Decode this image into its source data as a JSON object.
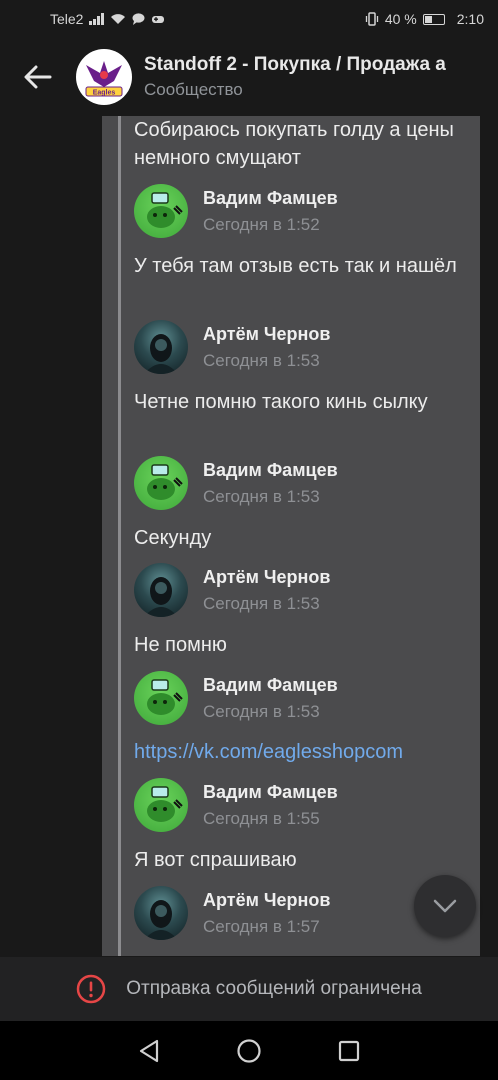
{
  "status_bar": {
    "carrier": "Tele2",
    "battery": "40 %",
    "time": "2:10"
  },
  "header": {
    "title": "Standoff 2 - Покупка / Продажа а",
    "subtitle": "Сообщество",
    "avatar_text": "Eagles"
  },
  "thread": {
    "messages": [
      {
        "text": "Собираюсь покупать голду а цены немного смущают"
      },
      {
        "author": "Вадим Фамцев",
        "time": "Сегодня в 1:52",
        "text": "У тебя там отзыв есть так и нашёл"
      },
      {
        "author": "Артём Чернов",
        "time": "Сегодня в 1:53",
        "text": "Четне помню такого кинь сылку"
      },
      {
        "author": "Вадим Фамцев",
        "time": "Сегодня в 1:53",
        "text": "Секунду"
      },
      {
        "author": "Артём Чернов",
        "time": "Сегодня в 1:53",
        "text": "Не помню"
      },
      {
        "author": "Вадим Фамцев",
        "time": "Сегодня в 1:53",
        "link": "https://vk.com/eaglesshopcom"
      },
      {
        "author": "Вадим Фамцев",
        "time": "Сегодня в 1:55",
        "text": "Я вот спрашиваю"
      },
      {
        "author": "Артём Чернов",
        "time": "Сегодня в 1:57"
      }
    ]
  },
  "restricted": {
    "text": "Отправка сообщений ограничена"
  },
  "colors": {
    "thread_bg": "#4b4b4d",
    "link": "#71aaeb",
    "alert_red": "#e64646"
  }
}
